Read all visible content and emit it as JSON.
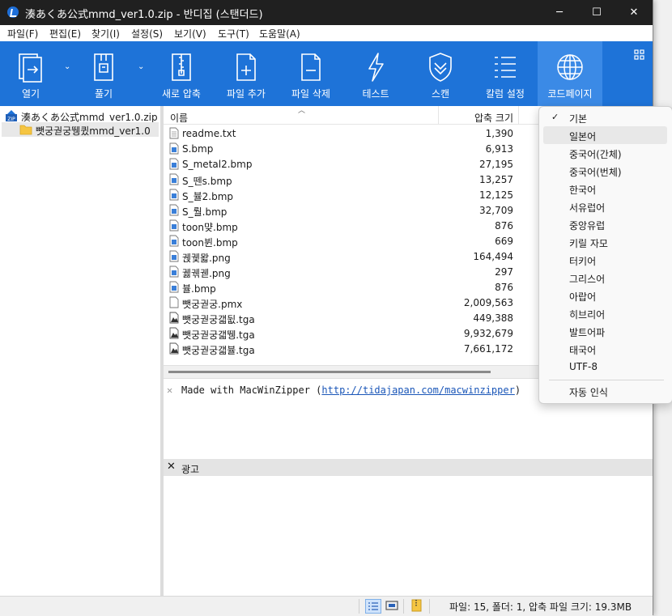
{
  "window": {
    "title": "湊あくあ公式mmd_ver1.0.zip - 반디집 (스탠더드)",
    "minimize": "─",
    "maximize": "☐",
    "close": "✕"
  },
  "menu": [
    "파일(F)",
    "편집(E)",
    "찾기(I)",
    "설정(S)",
    "보기(V)",
    "도구(T)",
    "도움말(A)"
  ],
  "toolbar": {
    "open": "열기",
    "extract": "풀기",
    "new_archive": "새로 압축",
    "add_file": "파일 추가",
    "delete_file": "파일 삭제",
    "test": "테스트",
    "scan": "스캔",
    "column_settings": "칼럼 설정",
    "codepage": "코드페이지"
  },
  "tree": {
    "archive": "湊あくあ公式mmd_ver1.0.zip",
    "folder": "뺏궁궏궁뛩큈mmd_ver1.0"
  },
  "list": {
    "col_name": "이름",
    "col_size": "압축 크기",
    "files": [
      {
        "name": "readme.txt",
        "size": "1,390",
        "type": "txt"
      },
      {
        "name": "S.bmp",
        "size": "6,913",
        "type": "bmp"
      },
      {
        "name": "S_metal2.bmp",
        "size": "27,195",
        "type": "bmp"
      },
      {
        "name": "S_뗀s.bmp",
        "size": "13,257",
        "type": "bmp"
      },
      {
        "name": "S_뷸2.bmp",
        "size": "12,125",
        "type": "bmp"
      },
      {
        "name": "S_뤌.bmp",
        "size": "32,709",
        "type": "bmp"
      },
      {
        "name": "toon먖.bmp",
        "size": "876",
        "type": "bmp"
      },
      {
        "name": "toon뷘.bmp",
        "size": "669",
        "type": "bmp"
      },
      {
        "name": "궩궻뫏.png",
        "size": "164,494",
        "type": "png"
      },
      {
        "name": "궳궦궫.png",
        "size": "297",
        "type": "png"
      },
      {
        "name": "뷸.bmp",
        "size": "876",
        "type": "bmp"
      },
      {
        "name": "뺏궁궏궁.pmx",
        "size": "2,009,563",
        "type": "pmx"
      },
      {
        "name": "뺏궁궏궁갧뒶.tga",
        "size": "449,388",
        "type": "tga"
      },
      {
        "name": "뺏궁궏궁갧뛩.tga",
        "size": "9,932,679",
        "type": "tga"
      },
      {
        "name": "뺏궁궏궁갧뷸.tga",
        "size": "7,661,172",
        "type": "tga"
      }
    ]
  },
  "info": {
    "prefix": "Made with MacWinZipper (",
    "link": "http://tidajapan.com/macwinzipper",
    "suffix": ")"
  },
  "ad": {
    "label": "광고",
    "close": "✕"
  },
  "status": {
    "text": "파일: 15, 폴더: 1, 압축 파일 크기: 19.3MB"
  },
  "codepage_menu": {
    "checked_index": 0,
    "hover_index": 1,
    "items": [
      "기본",
      "일본어",
      "중국어(간체)",
      "중국어(번체)",
      "한국어",
      "서유럽어",
      "중앙유럽",
      "키릴 자모",
      "터키어",
      "그리스어",
      "아랍어",
      "히브리어",
      "발트어파",
      "태국어",
      "UTF-8"
    ],
    "auto_detect": "자동 인식"
  },
  "colors": {
    "toolbar_bg": "#1e73d8",
    "toolbar_active": "#3b8ae6",
    "titlebar_bg": "#202020",
    "link": "#1a56b8"
  }
}
